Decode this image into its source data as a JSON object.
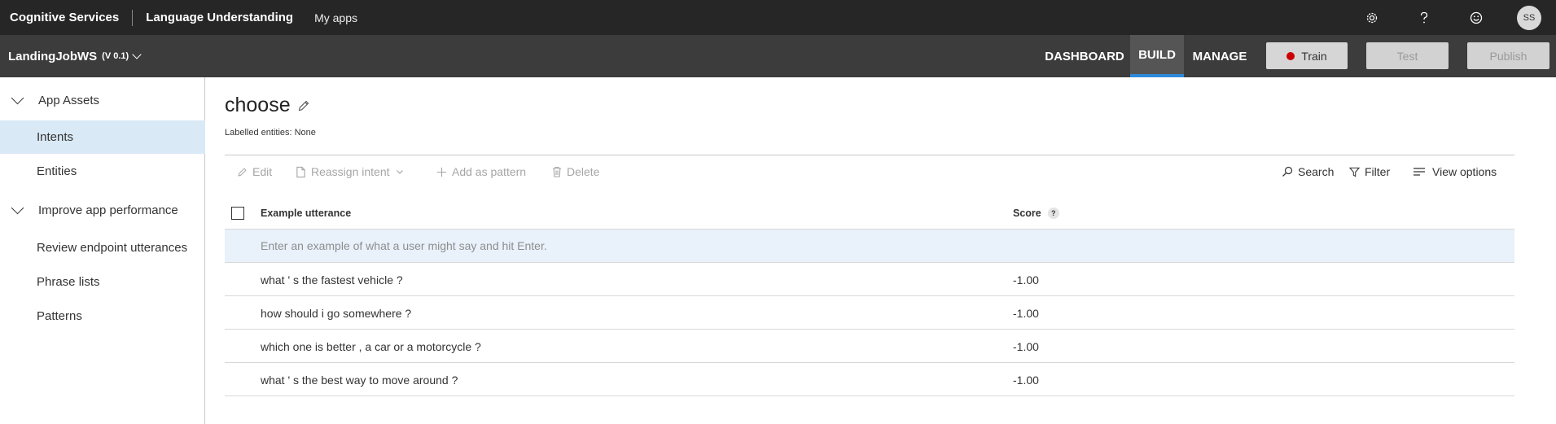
{
  "topbar": {
    "brand": "Cognitive Services",
    "product": "Language Understanding",
    "my_apps": "My apps",
    "avatar_initials": "SS",
    "icons": [
      "gear-icon",
      "help-icon",
      "smiley-icon"
    ]
  },
  "appbar": {
    "app_name": "LandingJobWS",
    "version": "(V 0.1)",
    "nav": {
      "dashboard": "DASHBOARD",
      "build": "BUILD",
      "manage": "MANAGE"
    },
    "train_label": "Train",
    "test_label": "Test",
    "publish_label": "Publish",
    "accent_color": "#2e8ad8",
    "train_status_color": "#cc0000"
  },
  "sidebar": {
    "sections": [
      {
        "label": "App Assets",
        "items": [
          "Intents",
          "Entities"
        ]
      },
      {
        "label": "Improve app performance",
        "items": [
          "Review endpoint utterances",
          "Phrase lists",
          "Patterns"
        ]
      }
    ],
    "active_item": "Intents"
  },
  "intent": {
    "title": "choose",
    "labelled_entities": "Labelled entities: None"
  },
  "toolbar": {
    "edit": "Edit",
    "reassign": "Reassign intent",
    "add_pattern": "Add as pattern",
    "delete": "Delete",
    "search": "Search",
    "filter": "Filter",
    "view_options": "View options"
  },
  "table": {
    "col_utterance": "Example utterance",
    "col_score": "Score",
    "help_glyph": "?",
    "input_placeholder": "Enter an example of what a user might say and hit Enter.",
    "rows": [
      {
        "utterance": "what ' s the fastest vehicle ?",
        "score": "-1.00"
      },
      {
        "utterance": "how should i go somewhere ?",
        "score": "-1.00"
      },
      {
        "utterance": "which one is better , a car or a motorcycle ?",
        "score": "-1.00"
      },
      {
        "utterance": "what ' s the best way to move around ?",
        "score": "-1.00"
      }
    ]
  }
}
